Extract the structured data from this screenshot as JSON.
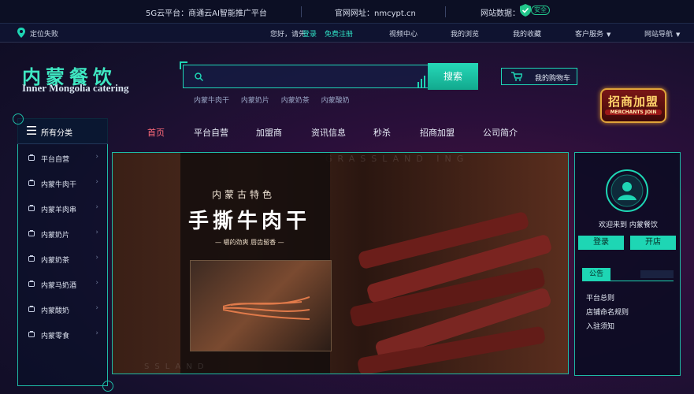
{
  "topbar": {
    "platform": "5G云平台：商通云AI智能推广平台",
    "site": "官网网址：nmcypt.cn",
    "site_data_label": "网站数据：",
    "safe_badge": "安全"
  },
  "userbar": {
    "location": "定位失败",
    "greeting": "您好，请先",
    "login": "登录",
    "register": "免费注册",
    "links": [
      "视频中心",
      "我的浏览",
      "我的收藏",
      "客户服务",
      "网站导航"
    ]
  },
  "logo": {
    "cn": "内蒙餐饮",
    "en": "Inner Mongolia catering"
  },
  "search": {
    "placeholder": "",
    "button": "搜索",
    "hot_words": [
      "内蒙牛肉干",
      "内蒙奶片",
      "内蒙奶茶",
      "内蒙酸奶"
    ]
  },
  "cart": {
    "label": "我的购物车"
  },
  "merchant": {
    "cn": "招商加盟",
    "en": "MERCHANTS JOIN"
  },
  "categories": {
    "title": "所有分类",
    "items": [
      "平台自营",
      "内蒙牛肉干",
      "内蒙羊肉串",
      "内蒙奶片",
      "内蒙奶茶",
      "内蒙马奶酒",
      "内蒙酸奶",
      "内蒙零食"
    ]
  },
  "mainnav": {
    "items": [
      "首页",
      "平台自营",
      "加盟商",
      "资讯信息",
      "秒杀",
      "招商加盟",
      "公司简介"
    ],
    "active_index": 0
  },
  "banner": {
    "subtitle": "内蒙古特色",
    "title": "手撕牛肉干",
    "tagline": "— 嚼的劲爽  唇齿留香 —",
    "watermark_top": "GRASSLAND ING",
    "watermark_bottom": "SSLAND"
  },
  "sidepanel": {
    "welcome": "欢迎来到 内蒙餐饮",
    "login_button": "登录",
    "shop_button": "开店",
    "notice_title": "公告",
    "notices": [
      "平台总则",
      "店铺命名规则",
      "入驻须知"
    ]
  },
  "colors": {
    "accent": "#1ed6b4",
    "active_nav": "#ff6b7a",
    "background": "#1a0f30"
  },
  "icons": [
    "location-pin-icon",
    "shield-check-icon",
    "search-icon",
    "cart-icon",
    "menu-icon",
    "user-avatar-icon",
    "chevron-right-icon",
    "chevron-down-icon"
  ]
}
